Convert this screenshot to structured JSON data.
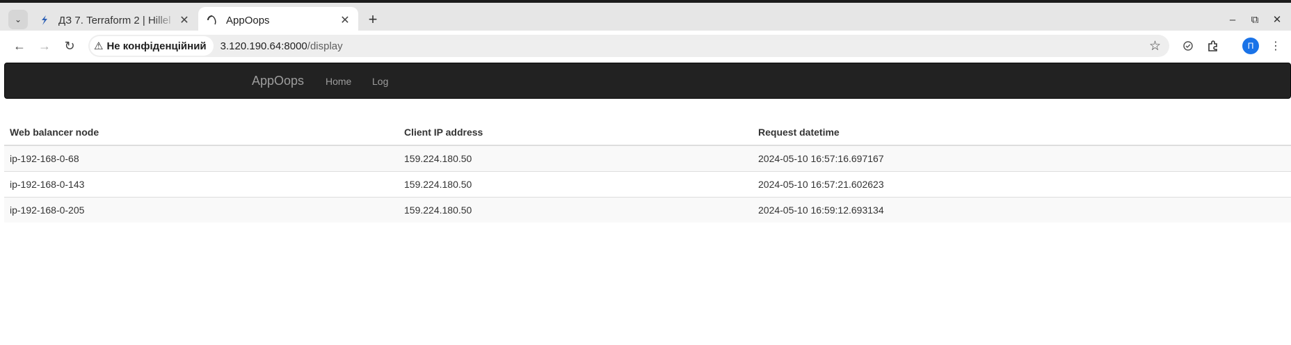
{
  "browser": {
    "tabs": [
      {
        "title": "ДЗ 7. Terraform 2 | Hillel"
      },
      {
        "title": "AppOops"
      }
    ],
    "security_label": "Не конфіденційний",
    "url_host": "3.120.190.64:8000",
    "url_path": "/display",
    "profile_initial": "П",
    "profile_color": "#1a73e8"
  },
  "app": {
    "brand": "AppOops",
    "nav": [
      "Home",
      "Log"
    ],
    "navbar_color": "#222222"
  },
  "table": {
    "headers": [
      "Web balancer node",
      "Client IP address",
      "Request datetime"
    ],
    "rows": [
      [
        "ip-192-168-0-68",
        "159.224.180.50",
        "2024-05-10 16:57:16.697167"
      ],
      [
        "ip-192-168-0-143",
        "159.224.180.50",
        "2024-05-10 16:57:21.602623"
      ],
      [
        "ip-192-168-0-205",
        "159.224.180.50",
        "2024-05-10 16:59:12.693134"
      ]
    ]
  }
}
